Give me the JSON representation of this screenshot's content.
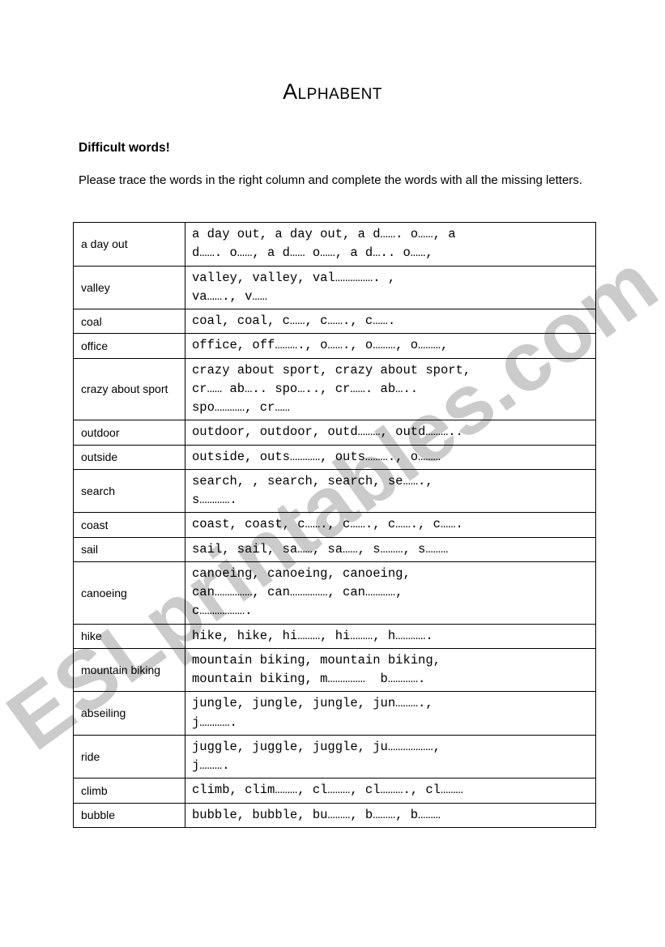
{
  "document": {
    "title": "Alphabent",
    "subtitle": "Difficult words!",
    "instructions": "Please trace the words in the right column and complete the words with all the missing letters.",
    "watermark": "ESLprintables.com"
  },
  "table": {
    "rows": [
      {
        "label": "a day out",
        "content": "a day out, a day out, a d……. o……, a\nd……. o……, a d…… o……, a d….. o……,"
      },
      {
        "label": "valley",
        "content": "valley, valley, val……………. ,\nva……., v……"
      },
      {
        "label": "coal",
        "content": "coal, coal, c……, c……., c……."
      },
      {
        "label": "office",
        "content": "office, off………., o……., o………, o………,"
      },
      {
        "label": "crazy about sport",
        "content": "crazy about sport, crazy about sport,\ncr…… ab….. spo….., cr……. ab…..\nspo…………, cr……"
      },
      {
        "label": "outdoor",
        "content": "outdoor, outdoor, outd………, outd……….."
      },
      {
        "label": "outside",
        "content": "outside, outs…………, outs………., o………"
      },
      {
        "label": "search",
        "content": "search, , search, search, se…….,\ns…………."
      },
      {
        "label": "coast",
        "content": "coast, coast, c……., c……., c……., c……."
      },
      {
        "label": "sail",
        "content": "sail, sail, sa……, sa……, s………, s………"
      },
      {
        "label": "canoeing",
        "content": "canoeing, canoeing, canoeing,\ncan……………, can……………, can…………,\nc………………."
      },
      {
        "label": "hike",
        "content": "hike, hike, hi………, hi………, h…………."
      },
      {
        "label": "mountain biking",
        "content": "mountain biking, mountain biking,\nmountain biking, m……………  b…………."
      },
      {
        "label": "abseiling",
        "content": "jungle, jungle, jungle, jun……….,\nj…………."
      },
      {
        "label": "ride",
        "content": "juggle, juggle, juggle, ju………………,\nj………."
      },
      {
        "label": "climb",
        "content": "climb, clim………, cl………, cl………., cl………"
      },
      {
        "label": "bubble",
        "content": "bubble, bubble, bu………, b………, b………"
      }
    ]
  }
}
